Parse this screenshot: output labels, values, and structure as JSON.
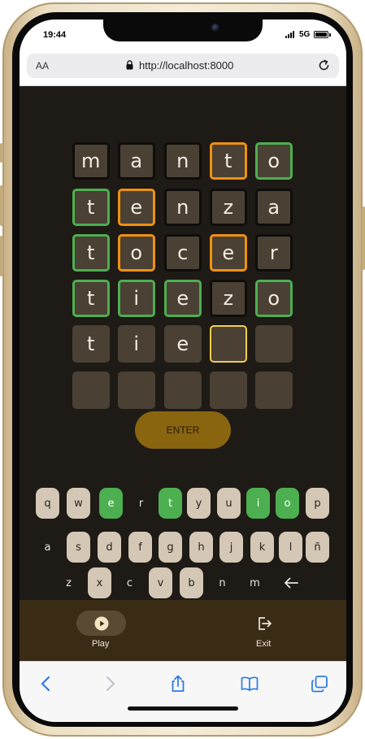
{
  "status_bar": {
    "time": "19:44",
    "network": "5G"
  },
  "browser": {
    "text_size_label": "AA",
    "url": "http://localhost:8000"
  },
  "board": {
    "rows": [
      [
        {
          "letter": "m",
          "state": "absent"
        },
        {
          "letter": "a",
          "state": "absent"
        },
        {
          "letter": "n",
          "state": "absent"
        },
        {
          "letter": "t",
          "state": "present"
        },
        {
          "letter": "o",
          "state": "correct"
        }
      ],
      [
        {
          "letter": "t",
          "state": "correct"
        },
        {
          "letter": "e",
          "state": "present"
        },
        {
          "letter": "n",
          "state": "absent"
        },
        {
          "letter": "z",
          "state": "absent"
        },
        {
          "letter": "a",
          "state": "absent"
        }
      ],
      [
        {
          "letter": "t",
          "state": "correct"
        },
        {
          "letter": "o",
          "state": "present"
        },
        {
          "letter": "c",
          "state": "absent"
        },
        {
          "letter": "e",
          "state": "present"
        },
        {
          "letter": "r",
          "state": "absent"
        }
      ],
      [
        {
          "letter": "t",
          "state": "correct"
        },
        {
          "letter": "i",
          "state": "correct"
        },
        {
          "letter": "e",
          "state": "correct"
        },
        {
          "letter": "z",
          "state": "absent"
        },
        {
          "letter": "o",
          "state": "correct"
        }
      ],
      [
        {
          "letter": "t",
          "state": "typed"
        },
        {
          "letter": "i",
          "state": "typed"
        },
        {
          "letter": "e",
          "state": "typed"
        },
        {
          "letter": "",
          "state": "current"
        },
        {
          "letter": "",
          "state": "empty"
        }
      ],
      [
        {
          "letter": "",
          "state": "empty"
        },
        {
          "letter": "",
          "state": "empty"
        },
        {
          "letter": "",
          "state": "empty"
        },
        {
          "letter": "",
          "state": "empty"
        },
        {
          "letter": "",
          "state": "empty"
        }
      ]
    ]
  },
  "enter_label": "ENTER",
  "keyboard": {
    "rows": [
      [
        {
          "key": "q",
          "state": "unused"
        },
        {
          "key": "w",
          "state": "unused"
        },
        {
          "key": "e",
          "state": "correct"
        },
        {
          "key": "r",
          "state": "absent"
        },
        {
          "key": "t",
          "state": "correct"
        },
        {
          "key": "y",
          "state": "unused"
        },
        {
          "key": "u",
          "state": "unused"
        },
        {
          "key": "i",
          "state": "correct"
        },
        {
          "key": "o",
          "state": "correct"
        },
        {
          "key": "p",
          "state": "unused"
        }
      ],
      [
        {
          "key": "a",
          "state": "absent"
        },
        {
          "key": "s",
          "state": "unused"
        },
        {
          "key": "d",
          "state": "unused"
        },
        {
          "key": "f",
          "state": "unused"
        },
        {
          "key": "g",
          "state": "unused"
        },
        {
          "key": "h",
          "state": "unused"
        },
        {
          "key": "j",
          "state": "unused"
        },
        {
          "key": "k",
          "state": "unused"
        },
        {
          "key": "l",
          "state": "unused"
        },
        {
          "key": "ñ",
          "state": "unused"
        }
      ],
      [
        {
          "key": "z",
          "state": "absent"
        },
        {
          "key": "x",
          "state": "unused"
        },
        {
          "key": "c",
          "state": "absent"
        },
        {
          "key": "v",
          "state": "unused"
        },
        {
          "key": "b",
          "state": "unused"
        },
        {
          "key": "n",
          "state": "absent"
        },
        {
          "key": "m",
          "state": "absent"
        },
        {
          "key": "",
          "state": "backspace",
          "icon": "backspace-arrow-icon"
        }
      ]
    ]
  },
  "app_nav": {
    "play": {
      "label": "Play",
      "icon": "play-icon",
      "active": true
    },
    "exit": {
      "label": "Exit",
      "icon": "exit-icon"
    }
  },
  "colors": {
    "background": "#1e1a16",
    "tile": "#4a4034",
    "correct": "#4caf50",
    "present": "#f0910f",
    "absent_border": "#0f0d0b",
    "current_border": "#f2cf4c",
    "enter_button": "#8a6510",
    "key": "#d4c7b5",
    "nav_bar": "#3a2b15"
  }
}
